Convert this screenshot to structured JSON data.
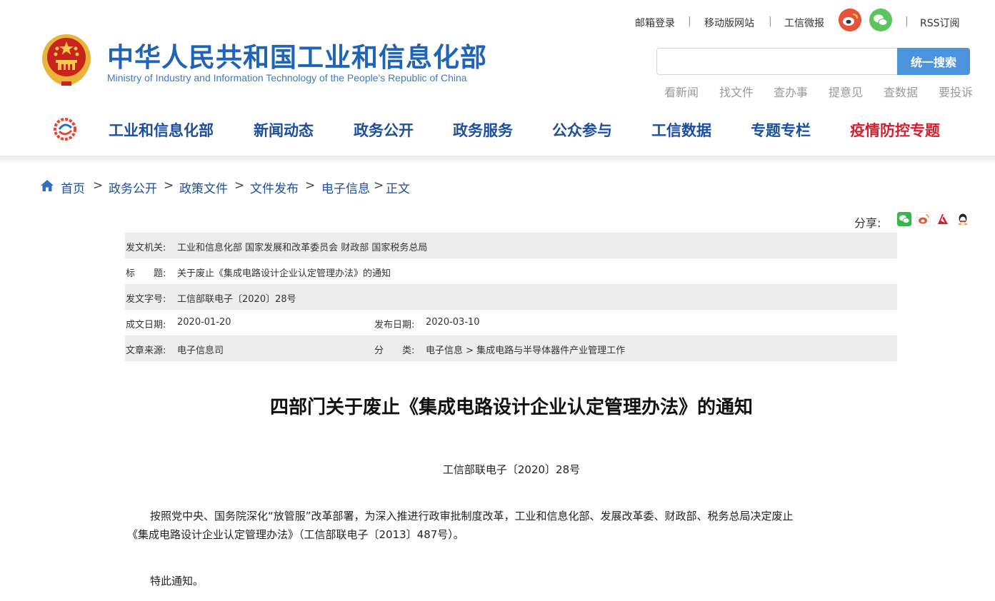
{
  "header": {
    "title": "中华人民共和国工业和信息化部",
    "subtitle": "Ministry of Industry and Information Technology of the People's Republic of China",
    "toplinks": {
      "mail_login": "邮箱登录",
      "mobile_site": "移动版网站",
      "weibo": "工信微报",
      "rss": "RSS订阅"
    },
    "search": {
      "placeholder": "",
      "button": "统一搜索"
    },
    "quick_links": [
      "看新闻",
      "找文件",
      "查办事",
      "提意见",
      "查数据",
      "要投诉"
    ],
    "nav": [
      "工业和信息化部",
      "新闻动态",
      "政务公开",
      "政务服务",
      "公众参与",
      "工信数据",
      "专题专栏",
      "疫情防控专题"
    ]
  },
  "breadcrumb": [
    "首页",
    "政务公开",
    "政策文件",
    "文件发布",
    "电子信息",
    "正文"
  ],
  "share": {
    "label": "分享:",
    "icons": [
      "wechat-icon",
      "weibo-icon",
      "renren-icon",
      "qq-icon"
    ]
  },
  "doc_info": {
    "issuer_label": "发文机关:",
    "issuer": "工业和信息化部 国家发展和改革委员会 财政部 国家税务总局",
    "title_label": "标　　题:",
    "title": "关于废止《集成电路设计企业认定管理办法》的通知",
    "number_label": "发文字号:",
    "number": "工信部联电子〔2020〕28号",
    "written_label": "成文日期:",
    "written": "2020-01-20",
    "published_label": "发布日期:",
    "published": "2020-03-10",
    "source_label": "文章来源:",
    "source": "电子信息司",
    "category_label": "分　　类:",
    "category": "电子信息 > 集成电路与半导体器件产业管理工作"
  },
  "article": {
    "title": "四部门关于废止《集成电路设计企业认定管理办法》的通知",
    "doc_number": "工信部联电子〔2020〕28号",
    "paragraph_line1": "按照党中央、国务院深化“放管服”改革部署，为深入推进行政审批制度改革，工业和信息化部、发展改革委、财政部、税务总局决定废止",
    "paragraph_line2": "《集成电路设计企业认定管理办法》（工信部联电子〔2013〕487号）。",
    "closing": "特此通知。"
  },
  "colors": {
    "brand_blue": "#1c4f9c",
    "title_blue": "#1f64b8",
    "search_button": "#4d93dc",
    "nav_red": "#d3202f",
    "table_gray": "#ededed"
  }
}
